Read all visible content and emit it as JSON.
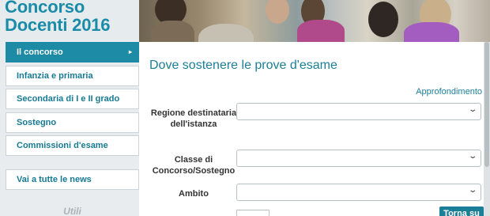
{
  "brand": {
    "line1": "Concorso",
    "line2": "Docenti 2016"
  },
  "sidebar": {
    "items": [
      {
        "label": "Il concorso",
        "arrow": "▸"
      },
      {
        "label": "Infanzia e primaria"
      },
      {
        "label": "Secondaria di I e II grado"
      },
      {
        "label": "Sostegno"
      },
      {
        "label": "Commissioni d'esame"
      }
    ],
    "news": "Vai a tutte le news",
    "utili": "Utili"
  },
  "main": {
    "title": "Dove sostenere le prove d'esame",
    "more_link": "Approfondimento",
    "fields": [
      {
        "label": "Regione destinataria dell'istanza",
        "value": ""
      },
      {
        "label": "Classe di Concorso/Sostegno",
        "value": ""
      },
      {
        "label": "Ambito",
        "value": ""
      }
    ],
    "top_button": "Torna su"
  },
  "icons": {
    "chevron": "chevron-down-icon",
    "arrow": "arrow-right-icon"
  },
  "colors": {
    "accent": "#1d8aa6",
    "brand": "#1b8ca8",
    "text_link": "#1b7f97"
  }
}
